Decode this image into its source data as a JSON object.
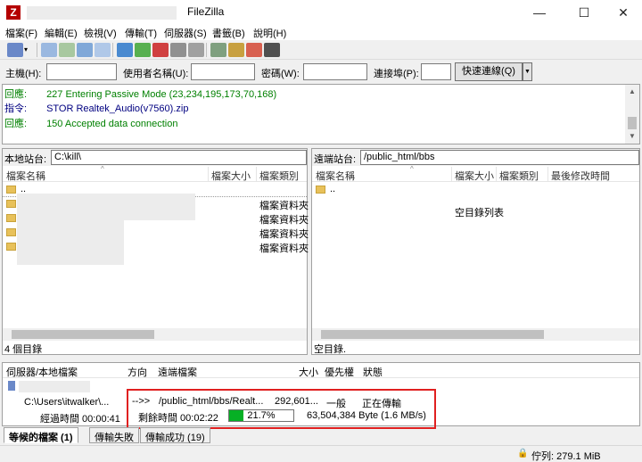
{
  "window": {
    "title": "FileZilla",
    "minimize": "—",
    "maximize": "☐",
    "close": "✕"
  },
  "menu": [
    "檔案(F)",
    "編輯(E)",
    "檢視(V)",
    "傳輸(T)",
    "伺服器(S)",
    "書籤(B)",
    "說明(H)"
  ],
  "quickconnect": {
    "host_label": "主機(H):",
    "user_label": "使用者名稱(U):",
    "pass_label": "密碼(W):",
    "port_label": "連接埠(P):",
    "button": "快速連線(Q)",
    "host_value": "",
    "user_value": "",
    "pass_value": "",
    "port_value": ""
  },
  "log": [
    {
      "type": "回應:",
      "msg": "227 Entering Passive Mode (23,234,195,173,70,168)",
      "color": "#008000"
    },
    {
      "type": "指令:",
      "msg": "STOR Realtek_Audio(v7560).zip",
      "color": "#000080"
    },
    {
      "type": "回應:",
      "msg": "150 Accepted data connection",
      "color": "#008000"
    }
  ],
  "local": {
    "site_label": "本地站台:",
    "path": "C:\\kill\\",
    "col_name": "檔案名稱",
    "col_size": "檔案大小",
    "col_type": "檔案類別",
    "parent": "..",
    "rows": [
      "檔案資料夾",
      "檔案資料夾",
      "檔案資料夾",
      "檔案資料夾"
    ],
    "status": "4 個目錄"
  },
  "remote": {
    "site_label": "遠端站台:",
    "path": "/public_html/bbs",
    "col_name": "檔案名稱",
    "col_size": "檔案大小",
    "col_type": "檔案類別",
    "col_modified": "最後修改時間",
    "parent": "..",
    "empty": "空目錄列表",
    "status": "空目錄."
  },
  "queue": {
    "col_server": "伺服器/本地檔案",
    "col_direction": "方向",
    "col_remote": "遠端檔案",
    "col_size": "大小",
    "col_priority": "優先權",
    "col_status": "狀態",
    "local_file": "C:\\Users\\itwalker\\...",
    "direction": "-->>",
    "remote_file": "/public_html/bbs/Realt...",
    "size": "292,601...",
    "priority": "一般",
    "status": "正在傳輸",
    "elapsed": "經過時間 00:00:41",
    "remaining": "剩餘時間 00:02:22",
    "progress_text": "21.7%",
    "progress": 0.217,
    "bytes": "63,504,384 Byte (1.6 MB/s)"
  },
  "tabs": [
    "等候的檔案 (1)",
    "傳輸失敗",
    "傳輸成功 (19)"
  ],
  "statusbar": {
    "queue": "佇列: 279.1 MiB"
  }
}
